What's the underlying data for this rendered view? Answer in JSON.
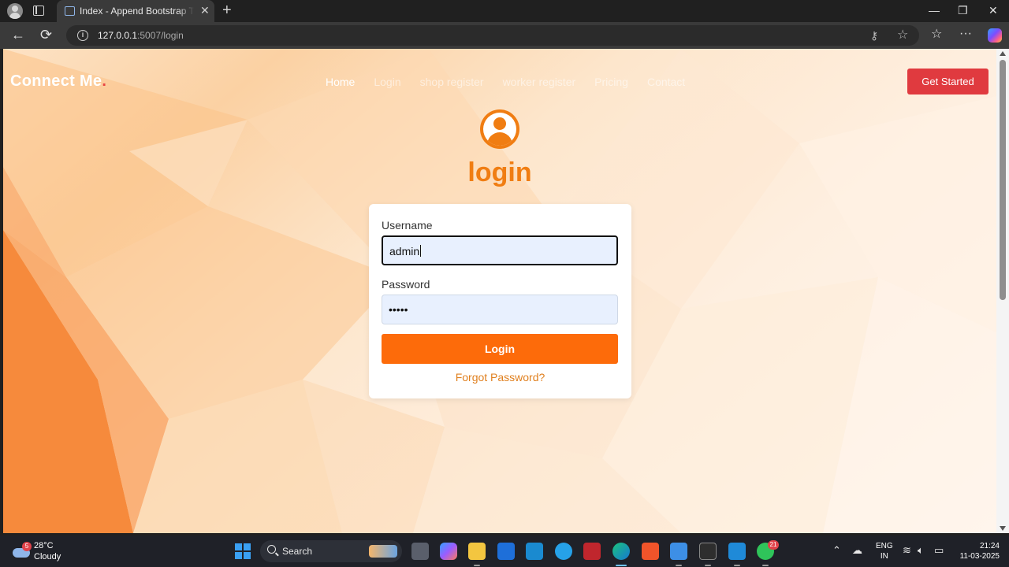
{
  "browser": {
    "tab_title": "Index - Append Bootstrap Template",
    "tab_close": "✕",
    "new_tab": "+",
    "url_host": "127.0.0.1",
    "url_path": ":5007/login",
    "window_controls": {
      "minimize": "—",
      "maximize": "❐",
      "close": "✕"
    },
    "nav": {
      "back": "←",
      "reload": "⟳"
    },
    "icons": {
      "profile": "profile-avatar-icon",
      "tabs": "tab-actions-icon",
      "info": "site-info-icon",
      "key": "password-key-icon",
      "star": "favorite-star-icon",
      "favorites": "favorites-icon",
      "more": "more-options-icon",
      "copilot": "copilot-icon"
    }
  },
  "site": {
    "brand": "Connect Me",
    "brand_dot": ".",
    "nav": [
      {
        "label": "Home",
        "active": true
      },
      {
        "label": "Login",
        "active": false
      },
      {
        "label": "shop register",
        "active": false
      },
      {
        "label": "worker register",
        "active": false
      },
      {
        "label": "Pricing",
        "active": false
      },
      {
        "label": "Contact",
        "active": false
      }
    ],
    "cta": "Get Started"
  },
  "login": {
    "title": "login",
    "username_label": "Username",
    "username_value": "admin",
    "password_label": "Password",
    "password_value": "•••••",
    "submit": "Login",
    "forgot": "Forgot Password?"
  },
  "colors": {
    "accent": "#f07d12",
    "button": "#fd6b0a",
    "cta": "#e03a3f",
    "brand_dot": "#e84545"
  },
  "taskbar": {
    "weather_badge": "5",
    "weather_temp": "28°C",
    "weather_desc": "Cloudy",
    "search": "Search",
    "whatsapp_badge": "21",
    "lang_top": "ENG",
    "lang_bottom": "IN",
    "time": "21:24",
    "date": "11-03-2025",
    "apps": [
      "task-view-icon",
      "copilot-app-icon",
      "file-explorer-icon",
      "microsoft-store-icon",
      "hp-icon",
      "safari-like-icon",
      "mcafee-icon",
      "edge-icon",
      "brave-icon",
      "app-icon",
      "terminal-icon",
      "vscode-icon",
      "whatsapp-icon"
    ]
  }
}
